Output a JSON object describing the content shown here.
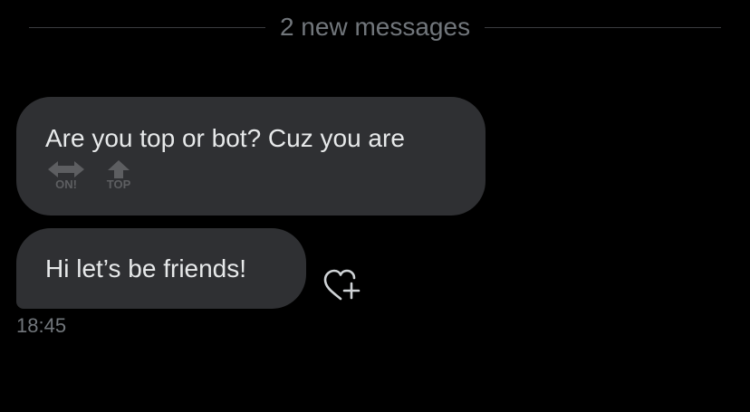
{
  "divider": {
    "label": "2 new messages"
  },
  "messages": [
    {
      "text": "Are you top or bot? Cuz you are",
      "emojis": [
        {
          "icon": "on-arrow-icon",
          "caption": "ON!"
        },
        {
          "icon": "top-arrow-icon",
          "caption": "TOP"
        }
      ]
    },
    {
      "text": "Hi let’s be friends!"
    }
  ],
  "timestamp": "18:45",
  "reaction": {
    "icon": "heart-plus-icon"
  },
  "colors": {
    "background": "#000000",
    "bubble": "#2f3033",
    "text": "#e7e9ea",
    "muted": "#71767b"
  }
}
